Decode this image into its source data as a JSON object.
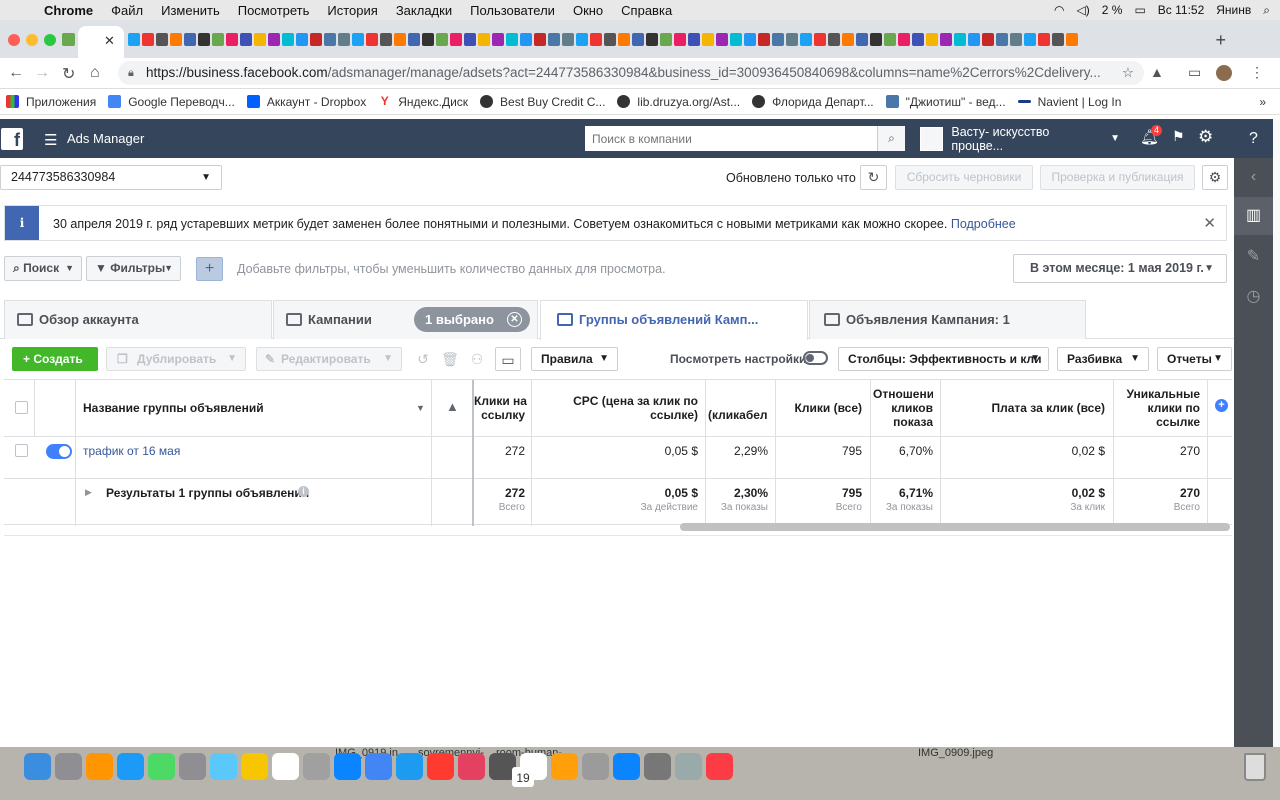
{
  "menubar": {
    "app": "Chrome",
    "items": [
      "Файл",
      "Изменить",
      "Посмотреть",
      "История",
      "Закладки",
      "Пользователи",
      "Окно",
      "Справка"
    ],
    "battery": "2 %",
    "clock": "Вс 11:52",
    "user": "Янинв"
  },
  "browser": {
    "url_host": "https://business.facebook.com",
    "url_path": "/adsmanager/manage/adsets?act=244773586330984&business_id=300936450840698&columns=name%2Cerrors%2Cdelivery...",
    "bookmarks": [
      "Приложения",
      "Google Переводч...",
      "Аккаунт - Dropbox",
      "Яндекс.Диск",
      "Best Buy Credit C...",
      "lib.druzya.org/Ast...",
      "Флорида Департ...",
      "\"Джиотиш\" - вед...",
      "Navient | Log In"
    ]
  },
  "fb": {
    "logo": "f",
    "title": "Ads Manager",
    "search_placeholder": "Поиск в компании",
    "account_name": "Васту- искусство процве...",
    "notif_count": "4"
  },
  "toolbar": {
    "account_id": "244773586330984",
    "updated": "Обновлено только что",
    "discard": "Сбросить черновики",
    "publish": "Проверка и публикация"
  },
  "banner": {
    "icon": "i",
    "text": "30 апреля 2019 г. ряд устаревших метрик будет заменен более понятными и полезными. Советуем ознакомиться с новыми метриками как можно скорее.",
    "link": "Подробнее"
  },
  "filters": {
    "search": "Поиск",
    "filters": "Фильтры",
    "placeholder": "Добавьте фильтры, чтобы уменьшить количество данных для просмотра.",
    "date": "В этом месяце: 1 мая 2019 г."
  },
  "tabs": {
    "overview": "Обзор аккаунта",
    "campaigns": "Кампании",
    "selected": "1 выбрано",
    "adsets": "Группы объявлений Камп...",
    "ads": "Объявления Кампания: 1"
  },
  "actions": {
    "create": "Создать",
    "duplicate": "Дублировать",
    "edit": "Редактировать",
    "rules": "Правила",
    "view_settings": "Посмотреть настройки",
    "columns": "Столбцы: Эффективность и кли",
    "breakdown": "Разбивка",
    "reports": "Отчеты"
  },
  "table": {
    "headers": {
      "name": "Название группы объявлений",
      "link_clicks": [
        "Клики на",
        "ссылку"
      ],
      "cpc": [
        "CPC (цена за клик по",
        "ссылке)"
      ],
      "ctr": "(кликабел",
      "clicks_all": "Клики (все)",
      "ratio": [
        "Отношени",
        "кликов",
        "показа"
      ],
      "cost_per_click": "Плата за клик (все)",
      "unique": [
        "Уникальные",
        "клики по",
        "ссылке"
      ]
    },
    "row": {
      "name": "трафик от 16 мая",
      "link_clicks": "272",
      "cpc": "0,05 $",
      "ctr": "2,29%",
      "clicks_all": "795",
      "ratio": "6,70%",
      "cost_per_click": "0,02 $",
      "unique": "270"
    },
    "totals": {
      "label": "Результаты 1 группы объявлений",
      "link_clicks": "272",
      "link_clicks_sub": "Всего",
      "cpc": "0,05 $",
      "cpc_sub": "За действие",
      "ctr": "2,30%",
      "ctr_sub": "За показы",
      "clicks_all": "795",
      "clicks_all_sub": "Всего",
      "ratio": "6,71%",
      "ratio_sub": "За показы",
      "cost_per_click": "0,02 $",
      "cost_per_click_sub": "За клик",
      "unique": "270",
      "unique_sub": "Всего"
    }
  },
  "dock": {
    "labels": [
      "IMG_0919.in",
      "sovremennyi-",
      "room-human-",
      "IMG_0909.jpeg"
    ],
    "calendar_day": "19"
  },
  "colors": {
    "fb_nav": "#35465c",
    "accent_blue": "#4267b2",
    "create_green": "#42b72a",
    "toggle_on": "#4080ff"
  }
}
